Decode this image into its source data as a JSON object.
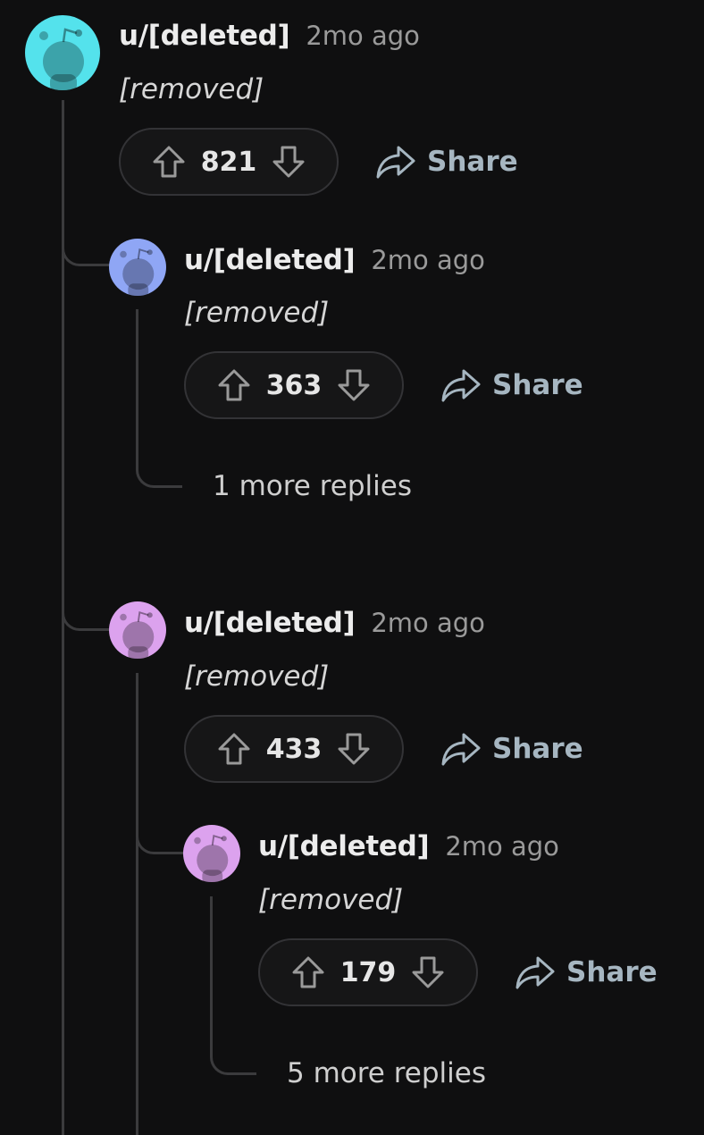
{
  "comments": [
    {
      "author": "u/[deleted]",
      "time": "2mo ago",
      "body": "[removed]",
      "score": "821",
      "share_label": "Share",
      "avatar_color": "#54e2ec"
    },
    {
      "author": "u/[deleted]",
      "time": "2mo ago",
      "body": "[removed]",
      "score": "363",
      "share_label": "Share",
      "avatar_color": "#8fa6f5"
    },
    {
      "author": "u/[deleted]",
      "time": "2mo ago",
      "body": "[removed]",
      "score": "433",
      "share_label": "Share",
      "avatar_color": "#dca2ee"
    },
    {
      "author": "u/[deleted]",
      "time": "2mo ago",
      "body": "[removed]",
      "score": "179",
      "share_label": "Share",
      "avatar_color": "#dca2ee"
    }
  ],
  "more_replies": [
    {
      "label": "1 more replies"
    },
    {
      "label": "5 more replies"
    }
  ],
  "icons": {
    "upvote": "upvote-arrow-icon",
    "downvote": "downvote-arrow-icon",
    "share": "share-arrow-icon",
    "avatar": "snoo-avatar-icon"
  },
  "colors": {
    "background": "#0f0f10",
    "thread_line": "#3b3b3d",
    "share_text": "#a6b6c1",
    "timestamp": "#9a9a9a"
  }
}
